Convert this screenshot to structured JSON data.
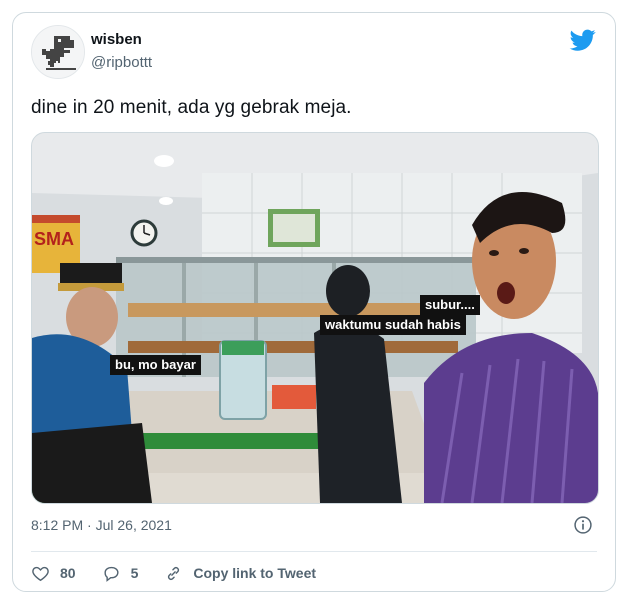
{
  "user": {
    "name": "wisben",
    "handle": "@ripbottt"
  },
  "tweet": {
    "text": "dine in 20 menit, ada yg gebrak meja.",
    "timestamp": "8:12 PM · Jul 26, 2021"
  },
  "meme": {
    "label_left": "bu, mo bayar",
    "label_right_1": "subur....",
    "label_right_2": "waktumu sudah habis",
    "shop_sign": "SMA"
  },
  "actions": {
    "likes": "80",
    "replies": "5",
    "copy_link": "Copy link to Tweet"
  },
  "colors": {
    "twitter_blue": "#1d9bf0",
    "muted": "#536471",
    "heart": "#536471"
  },
  "icons": [
    "twitter-bird-icon",
    "info-icon",
    "heart-icon",
    "reply-icon",
    "link-icon"
  ]
}
